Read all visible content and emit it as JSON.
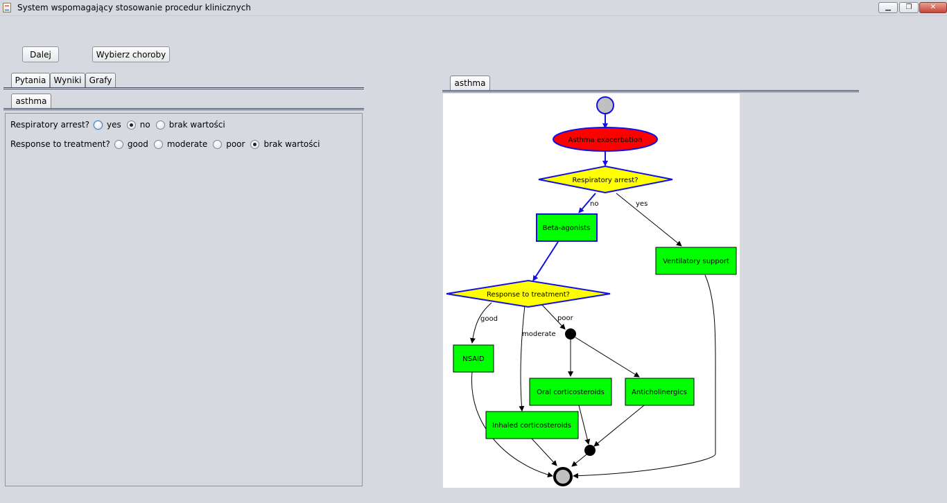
{
  "window": {
    "title": "System wspomagający stosowanie procedur klinicznych",
    "minimize": "▁",
    "maximize": "❐",
    "close": "✕"
  },
  "toolbar": {
    "next_label": "Dalej",
    "choose_label": "Wybierz choroby"
  },
  "left_tabs": [
    {
      "label": "Pytania",
      "active": true
    },
    {
      "label": "Wyniki",
      "active": false
    },
    {
      "label": "Grafy",
      "active": false
    }
  ],
  "disease_tab": {
    "label": "asthma"
  },
  "questions": [
    {
      "label": "Respiratory arrest?",
      "options": [
        "yes",
        "no",
        "brak wartości"
      ],
      "selected": "no"
    },
    {
      "label": "Response to treatment?",
      "options": [
        "good",
        "moderate",
        "poor",
        "brak wartości"
      ],
      "selected": "brak wartości"
    }
  ],
  "graph_tab": {
    "label": "asthma"
  },
  "graph": {
    "nodes": {
      "exacerbation": "Asthma exacerbation",
      "resp_arrest": "Respiratory arrest?",
      "beta_agonists": "Beta-agonists",
      "ventilatory": "Ventilatory support",
      "response": "Response to treatment?",
      "nsaid": "NSAID",
      "oral_cs": "Oral corticosteroids",
      "anticholinergics": "Anticholinergics",
      "inhaled_cs": "Inhaled corticosteroids"
    },
    "edges": {
      "no": "no",
      "yes": "yes",
      "good": "good",
      "moderate": "moderate",
      "poor": "poor"
    },
    "colors": {
      "active_edge": "#1010e0",
      "ellipse": "#ff0000",
      "decision": "#ffff00",
      "action": "#00ff00",
      "start": "#c0c0c0"
    }
  }
}
